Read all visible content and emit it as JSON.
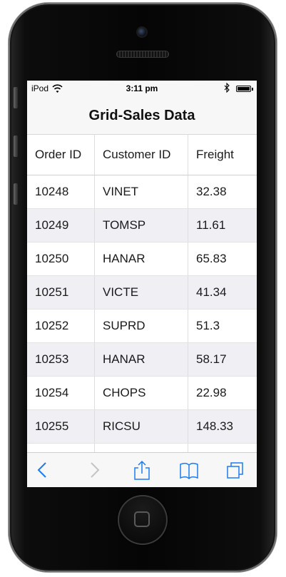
{
  "status_bar": {
    "carrier": "iPod",
    "time": "3:11 pm"
  },
  "header": {
    "title": "Grid-Sales Data"
  },
  "grid": {
    "columns": [
      "Order ID",
      "Customer ID",
      "Freight"
    ],
    "rows": [
      [
        "10248",
        "VINET",
        "32.38"
      ],
      [
        "10249",
        "TOMSP",
        "11.61"
      ],
      [
        "10250",
        "HANAR",
        "65.83"
      ],
      [
        "10251",
        "VICTE",
        "41.34"
      ],
      [
        "10252",
        "SUPRD",
        "51.3"
      ],
      [
        "10253",
        "HANAR",
        "58.17"
      ],
      [
        "10254",
        "CHOPS",
        "22.98"
      ],
      [
        "10255",
        "RICSU",
        "148.33"
      ]
    ]
  },
  "toolbar": {
    "icons": [
      "back-icon",
      "forward-icon",
      "share-icon",
      "bookmarks-icon",
      "tabs-icon"
    ]
  },
  "colors": {
    "accent": "#1a7cf5",
    "row_alt": "#efeff4",
    "bar": "#f7f7f7"
  }
}
